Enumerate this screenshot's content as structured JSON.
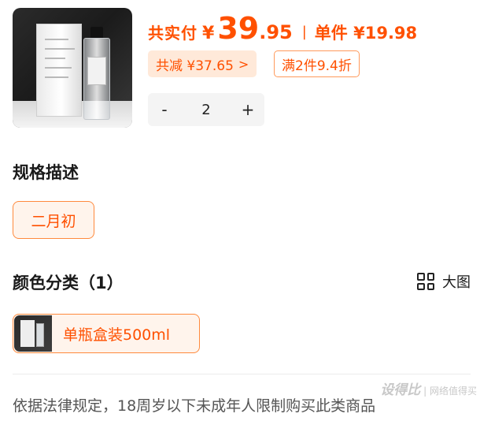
{
  "product": {
    "thumbnail_alt": "product-bottle-and-box"
  },
  "price": {
    "label": "共实付",
    "currency": "¥",
    "integer": "39",
    "decimal": ".95",
    "separator": "|",
    "unit_text": "单件 ¥19.98"
  },
  "chips": {
    "saving": "共减 ¥37.65",
    "saving_chevron": ">",
    "promo": "满2件9.4折"
  },
  "quantity": {
    "minus": "-",
    "value": "2",
    "plus": "+"
  },
  "spec": {
    "title": "规格描述",
    "selected_option": "二月初"
  },
  "color": {
    "title": "颜色分类（1）",
    "view_toggle_label": "大图",
    "selected_option": "单瓶盒装500ml"
  },
  "notice": "依据法律规定，18周岁以下未成年人限制购买此类商品",
  "watermark": {
    "brand": "设得比",
    "sub": "|  网络值得买"
  },
  "colors": {
    "accent": "#ff5000",
    "chip_bg": "#ffe9d9",
    "option_bg": "#fff4ec"
  }
}
